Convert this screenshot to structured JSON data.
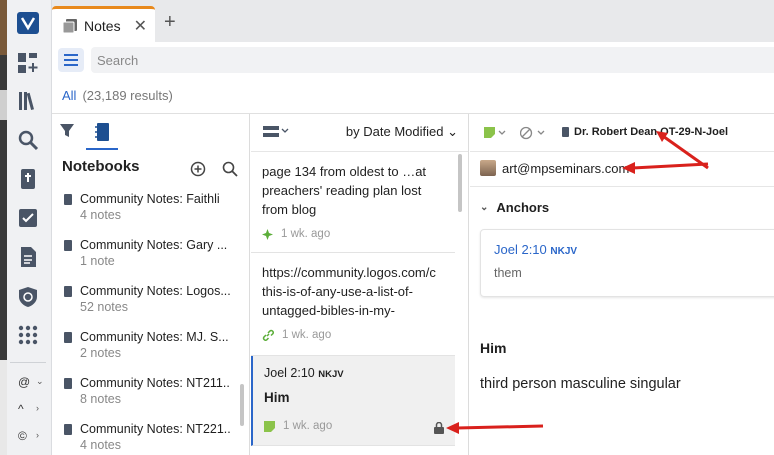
{
  "app": {
    "tab_label": "Notes",
    "tab_close": "✕",
    "new_tab": "+"
  },
  "search": {
    "placeholder": "Search"
  },
  "results": {
    "filter_label": "All",
    "count_text": "(23,189 results)"
  },
  "sidebar": {
    "bottom_items": [
      "@",
      "^",
      "©"
    ]
  },
  "notebooks": {
    "title": "Notebooks",
    "items": [
      {
        "title": "Community Notes: Faithli",
        "count": "4 notes"
      },
      {
        "title": "Community Notes: Gary ...",
        "count": "1 note"
      },
      {
        "title": "Community Notes: Logos...",
        "count": "52 notes"
      },
      {
        "title": "Community Notes: MJ. S...",
        "count": "2 notes"
      },
      {
        "title": "Community Notes: NT211...",
        "count": "8 notes"
      },
      {
        "title": "Community Notes: NT221...",
        "count": "4 notes"
      }
    ]
  },
  "notes": {
    "sort_label": "by Date Modified",
    "items": [
      {
        "text": "page 134 from oldest to …at preachers' reading plan lost from blog",
        "time": "1 wk. ago"
      },
      {
        "text": "https://community.logos.com/discussion/this-is-of-any-use-a-list-of-untagged-bibles-in-my-",
        "text_lines": [
          "https://community.logos.com/c",
          "this-is-of-any-use-a-list-of-",
          "untagged-bibles-in-my-"
        ],
        "time": "1 wk. ago"
      },
      {
        "ref": "Joel 2:10",
        "version": "NKJV",
        "title": "Him",
        "time": "1 wk. ago"
      }
    ]
  },
  "detail": {
    "notebook_title": "Dr. Robert Dean OT-29-N-Joel",
    "user_email": "art@mpseminars.com",
    "anchors_label": "Anchors",
    "anchor_ref": "Joel 2:10",
    "anchor_version": "NKJV",
    "anchor_quote": "them",
    "heading": "Him",
    "body": "third person masculine singular"
  },
  "colors": {
    "accent": "#2a66c9",
    "tab_accent": "#e8891c",
    "note_green": "#8bc34a",
    "annotation_red": "#d9211c"
  }
}
